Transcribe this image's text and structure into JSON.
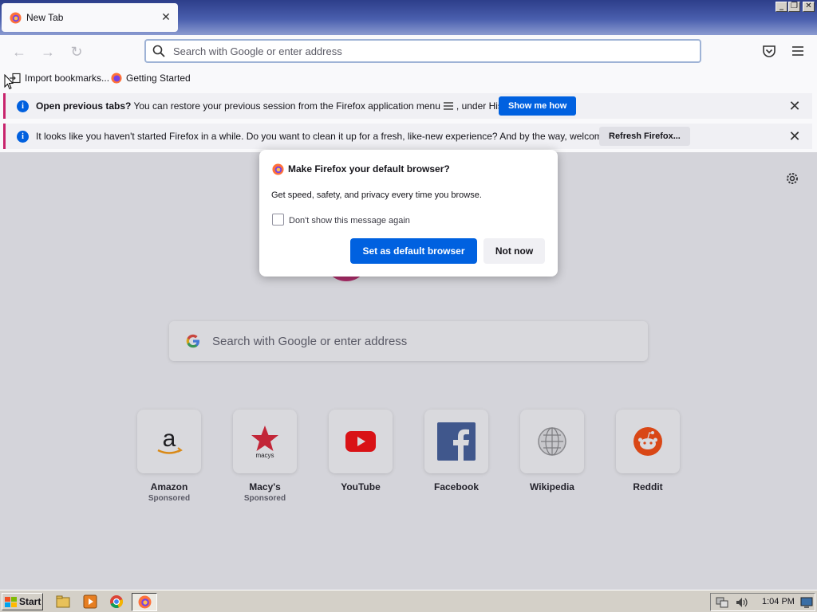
{
  "tab": {
    "title": "New Tab",
    "close": "✕"
  },
  "window_controls": {
    "minimize": "_",
    "restore": "❐",
    "close": "✕"
  },
  "navbar": {
    "url_placeholder": "Search with Google or enter address"
  },
  "bookmarks": [
    {
      "label": "Import bookmarks..."
    },
    {
      "label": "Getting Started"
    }
  ],
  "notifications": [
    {
      "bold": "Open previous tabs?",
      "text": " You can restore your previous session from the Firefox application menu ",
      "text_after": ", under History.",
      "button": "Show me how"
    },
    {
      "text": "It looks like you haven't started Firefox in a while. Do you want to clean it up for a fresh, like-new experience? And by the way, welcome back!",
      "button": "Refresh Firefox..."
    }
  ],
  "search": {
    "placeholder": "Search with Google or enter address"
  },
  "top_sites": [
    {
      "name": "Amazon",
      "sponsored": "Sponsored"
    },
    {
      "name": "Macy's",
      "sponsored": "Sponsored"
    },
    {
      "name": "YouTube",
      "sponsored": ""
    },
    {
      "name": "Facebook",
      "sponsored": ""
    },
    {
      "name": "Wikipedia",
      "sponsored": ""
    },
    {
      "name": "Reddit",
      "sponsored": ""
    }
  ],
  "dialog": {
    "title": "Make Firefox your default browser?",
    "description": "Get speed, safety, and privacy every time you browse.",
    "checkbox_label": "Don't show this message again",
    "checkbox_checked": false,
    "primary_button": "Set as default browser",
    "secondary_button": "Not now"
  },
  "taskbar": {
    "start": "Start",
    "clock": "1:04 PM"
  },
  "colors": {
    "accent": "#0061e0",
    "firefox_pink": "#c8246d",
    "titlebar": "#2d3e8a"
  }
}
